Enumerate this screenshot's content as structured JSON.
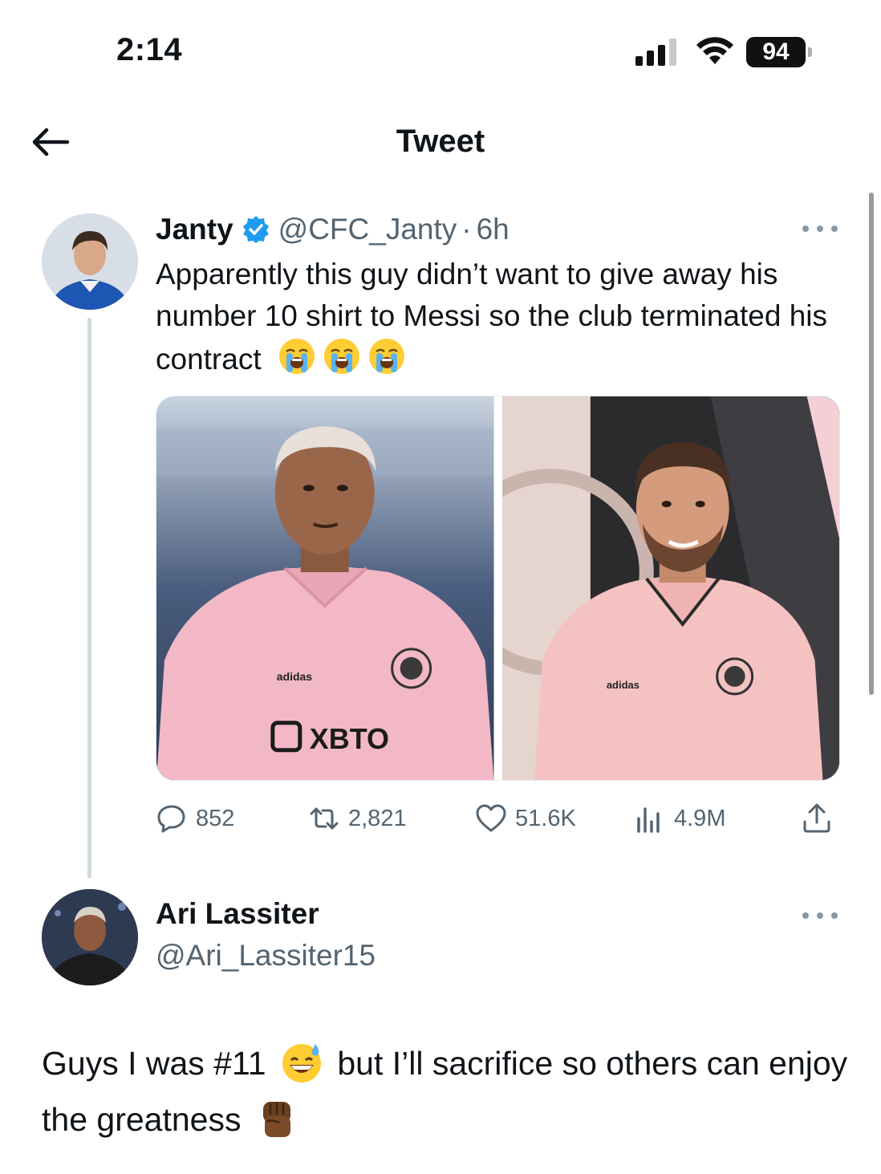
{
  "status_bar": {
    "time": "2:14",
    "battery": "94",
    "icons": [
      "signal-icon",
      "wifi-icon",
      "battery-icon"
    ]
  },
  "header": {
    "title": "Tweet",
    "back_icon": "back-arrow-icon"
  },
  "tweet": {
    "author": "Janty",
    "verified": true,
    "handle": "@CFC_Janty",
    "separator": "·",
    "time": "6h",
    "text": "Apparently this guy didn’t want to give away his number 10 shirt to Messi so the club terminated his contract",
    "emojis": [
      "loudly-crying-face",
      "loudly-crying-face",
      "loudly-crying-face"
    ],
    "media": [
      {
        "description_icon": "photo-player-pink-jersey",
        "jersey_sponsor": "XBTO",
        "brand": "adidas"
      },
      {
        "description_icon": "photo-messi-pink-jersey",
        "brand": "adidas"
      }
    ],
    "stats": {
      "replies": "852",
      "retweets": "2,821",
      "likes": "51.6K",
      "views": "4.9M"
    }
  },
  "reply": {
    "author": "Ari Lassiter",
    "handle": "@Ari_Lassiter15",
    "text_part1": "Guys I was #11",
    "text_part2": "but I’ll sacrifice so others can enjoy the greatness",
    "emojis": [
      "grinning-sweat-face",
      "raised-fist-dark"
    ]
  },
  "colors": {
    "text": "#0f1419",
    "secondary": "#536471",
    "verified": "#1d9bf0",
    "thread_line": "#cfd9de",
    "jersey_pink": "#f2b8c6"
  }
}
